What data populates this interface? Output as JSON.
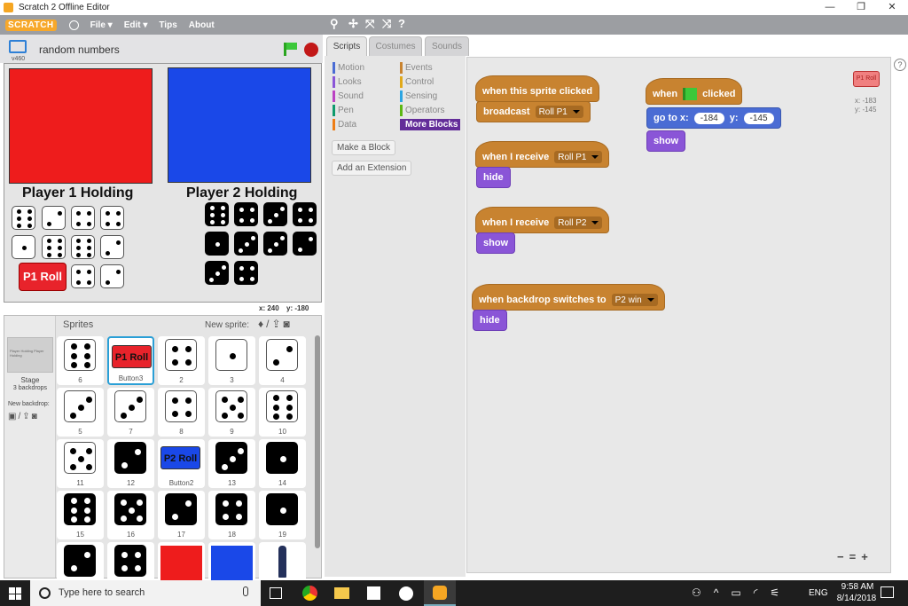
{
  "window": {
    "title": "Scratch 2 Offline Editor",
    "controls": [
      "—",
      "❐",
      "✕"
    ]
  },
  "menu": {
    "logo": "SCRATCH",
    "items": [
      "File ▾",
      "Edit ▾",
      "Tips",
      "About"
    ]
  },
  "stage": {
    "project_name": "random numbers",
    "version": "v460",
    "p1_label": "Player 1 Holding",
    "p2_label": "Player 2 Holding",
    "p1_button": "P1 Roll",
    "coords_x": "x: 240",
    "coords_y": "y: -180"
  },
  "sprites_panel": {
    "title": "Sprites",
    "new_sprite": "New sprite:",
    "stage_label": "Stage",
    "stage_sub": "3 backdrops",
    "new_backdrop": "New backdrop:",
    "stage_thumb_text": "Player Holding     Player Holding",
    "tiles": [
      {
        "label": "6",
        "kind": "die",
        "pips": 6,
        "black": false
      },
      {
        "label": "Button3",
        "kind": "button",
        "text": "P1 Roll",
        "color": "#e8232b",
        "selected": true
      },
      {
        "label": "2",
        "kind": "die",
        "pips": 4,
        "black": false
      },
      {
        "label": "3",
        "kind": "die",
        "pips": 1,
        "black": false
      },
      {
        "label": "4",
        "kind": "die",
        "pips": 2,
        "black": false
      },
      {
        "label": "5",
        "kind": "die",
        "pips": 3,
        "black": false
      },
      {
        "label": "7",
        "kind": "die",
        "pips": 3,
        "black": false
      },
      {
        "label": "8",
        "kind": "die",
        "pips": 4,
        "black": false
      },
      {
        "label": "9",
        "kind": "die",
        "pips": 5,
        "black": false
      },
      {
        "label": "10",
        "kind": "die",
        "pips": 6,
        "black": false
      },
      {
        "label": "11",
        "kind": "die",
        "pips": 5,
        "black": false
      },
      {
        "label": "12",
        "kind": "die",
        "pips": 2,
        "black": true
      },
      {
        "label": "Button2",
        "kind": "button",
        "text": "P2 Roll",
        "color": "#1a48e8",
        "selected": false
      },
      {
        "label": "13",
        "kind": "die",
        "pips": 3,
        "black": true
      },
      {
        "label": "14",
        "kind": "die",
        "pips": 1,
        "black": true
      },
      {
        "label": "15",
        "kind": "die",
        "pips": 6,
        "black": true
      },
      {
        "label": "16",
        "kind": "die",
        "pips": 5,
        "black": true
      },
      {
        "label": "17",
        "kind": "die",
        "pips": 2,
        "black": true
      },
      {
        "label": "18",
        "kind": "die",
        "pips": 4,
        "black": true
      },
      {
        "label": "19",
        "kind": "die",
        "pips": 1,
        "black": true
      },
      {
        "label": "",
        "kind": "die",
        "pips": 2,
        "black": true
      },
      {
        "label": "",
        "kind": "die",
        "pips": 4,
        "black": true
      },
      {
        "label": "",
        "kind": "color",
        "color": "#ee1c1c"
      },
      {
        "label": "",
        "kind": "color",
        "color": "#1a48e8"
      },
      {
        "label": "",
        "kind": "person"
      }
    ]
  },
  "tabs": [
    "Scripts",
    "Costumes",
    "Sounds"
  ],
  "categories": [
    {
      "name": "Motion",
      "color": "#4a6cd4"
    },
    {
      "name": "Events",
      "color": "#c88330"
    },
    {
      "name": "Looks",
      "color": "#8a55d7"
    },
    {
      "name": "Control",
      "color": "#e1a91a"
    },
    {
      "name": "Sound",
      "color": "#bb42c3"
    },
    {
      "name": "Sensing",
      "color": "#2ca5e2"
    },
    {
      "name": "Pen",
      "color": "#0e9a6c"
    },
    {
      "name": "Operators",
      "color": "#5cb712"
    },
    {
      "name": "Data",
      "color": "#ee7d16"
    },
    {
      "name": "More Blocks",
      "color": "#632d99"
    }
  ],
  "palette_buttons": [
    "Make a Block",
    "Add an Extension"
  ],
  "scripts": {
    "s1_hat": "when this sprite clicked",
    "s1_b1": "broadcast",
    "s1_b1_val": "Roll P1",
    "s2_hat": "when I receive",
    "s2_val": "Roll P1",
    "s2_b1": "hide",
    "s3_hat": "when I receive",
    "s3_val": "Roll P2",
    "s3_b1": "show",
    "s4_hat": "when backdrop switches to",
    "s4_val": "P2 win",
    "s4_b1": "hide",
    "s5_when": "when",
    "s5_clicked": "clicked",
    "s5_goto": "go to x:",
    "s5_x": "-184",
    "s5_y_label": "y:",
    "s5_y": "-145",
    "s5_b2": "show",
    "sprite_preview": "P1 Roll",
    "sprite_x": "x: -183",
    "sprite_y": "y: -145"
  },
  "zoom": [
    "−",
    "=",
    "+"
  ],
  "taskbar": {
    "search": "Type here to search",
    "lang": "ENG",
    "time": "9:58 AM",
    "date": "8/14/2018"
  }
}
